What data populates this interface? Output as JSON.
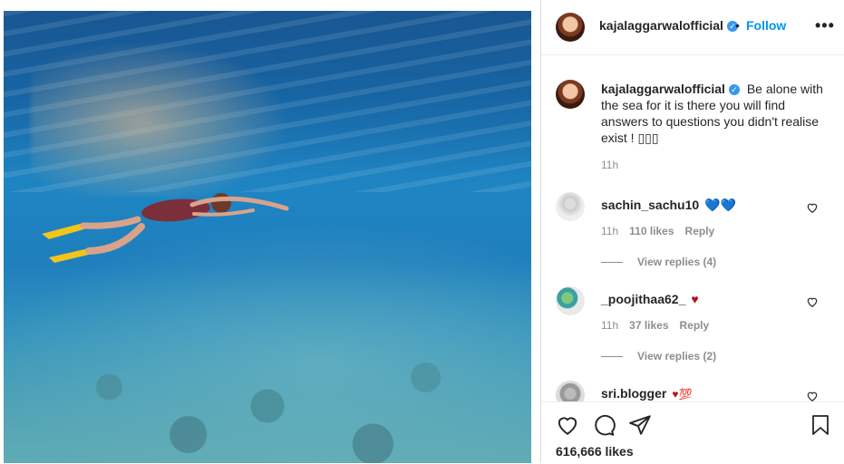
{
  "post": {
    "username": "kajalaggarwalofficial",
    "verified_mark": "✓",
    "dot": "•",
    "follow_label": "Follow",
    "more_label": "•••",
    "caption": "Be alone with the sea for it is there you will find answers to questions you didn't realise exist ! ▯▯▯",
    "caption_time": "11h",
    "likes_text": "616,666 likes"
  },
  "comments": [
    {
      "username": "sachin_sachu10",
      "emoji": "💙💙",
      "time": "11h",
      "likes": "110 likes",
      "reply_label": "Reply",
      "view_replies": "View replies (4)"
    },
    {
      "username": "_poojithaa62_",
      "emoji": "♥",
      "time": "11h",
      "likes": "37 likes",
      "reply_label": "Reply",
      "view_replies": "View replies (2)"
    },
    {
      "username": "sri.blogger",
      "emoji": "♥💯"
    }
  ],
  "icons": {
    "like": "heart-icon",
    "comment": "comment-icon",
    "share": "share-icon",
    "save": "bookmark-icon",
    "options": "more-options-icon"
  },
  "colors": {
    "accent": "#0095f6",
    "verified": "#3897f0",
    "heart_red": "#b5121b",
    "muted": "#8e8e8e"
  }
}
